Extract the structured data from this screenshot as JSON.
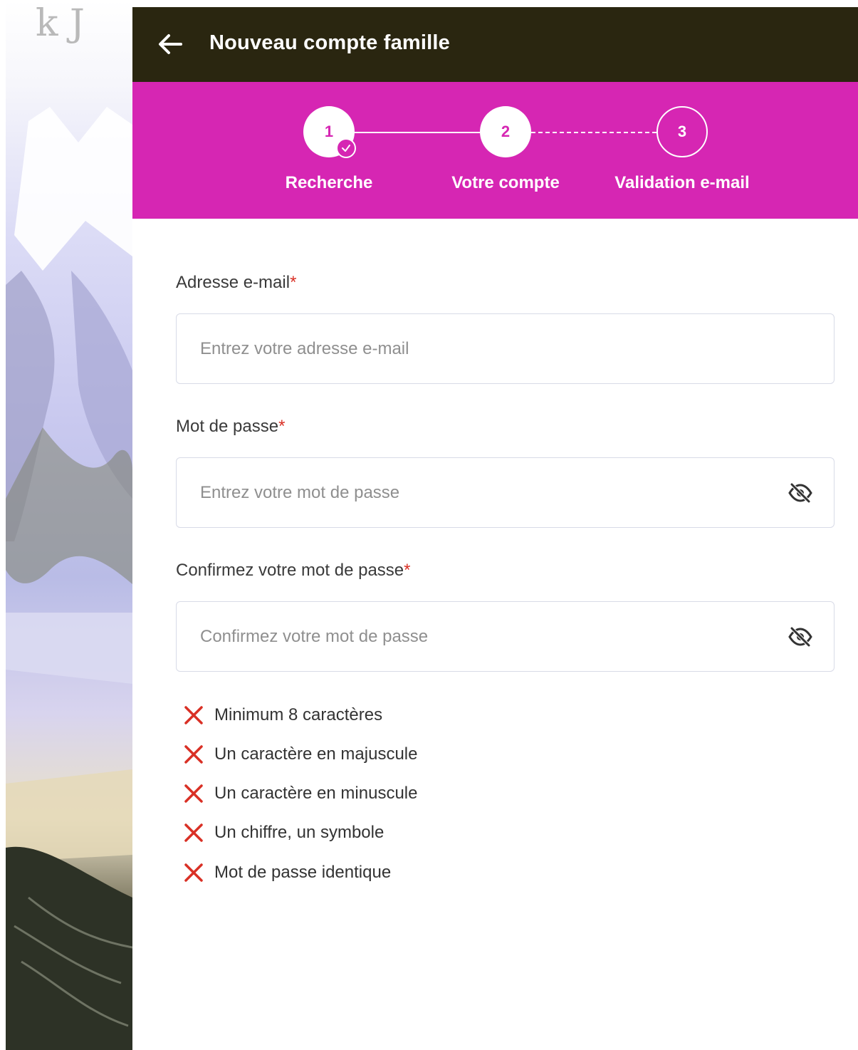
{
  "header": {
    "title": "Nouveau compte famille",
    "back_icon": "arrow-left-icon"
  },
  "stepper": {
    "steps": [
      {
        "number": "1",
        "label": "Recherche",
        "state": "completed"
      },
      {
        "number": "2",
        "label": "Votre compte",
        "state": "active"
      },
      {
        "number": "3",
        "label": "Validation e-mail",
        "state": "pending"
      }
    ],
    "accent_color": "#d626b3"
  },
  "form": {
    "email": {
      "label": "Adresse e-mail",
      "required_mark": "*",
      "placeholder": "Entrez votre adresse e-mail",
      "value": ""
    },
    "password": {
      "label": "Mot de passe",
      "required_mark": "*",
      "placeholder": "Entrez votre mot de passe",
      "value": "",
      "toggle_icon": "eye-off-icon"
    },
    "confirm": {
      "label": "Confirmez votre mot de passe",
      "required_mark": "*",
      "placeholder": "Confirmez votre mot de passe",
      "value": "",
      "toggle_icon": "eye-off-icon"
    }
  },
  "password_rules": [
    {
      "text": "Minimum 8 caractères",
      "status": "invalid"
    },
    {
      "text": "Un caractère en majuscule",
      "status": "invalid"
    },
    {
      "text": "Un caractère en minuscule",
      "status": "invalid"
    },
    {
      "text": "Un chiffre, un symbole",
      "status": "invalid"
    },
    {
      "text": "Mot de passe identique",
      "status": "invalid"
    }
  ],
  "colors": {
    "header_bg": "#2a2610",
    "invalid": "#d93025"
  }
}
